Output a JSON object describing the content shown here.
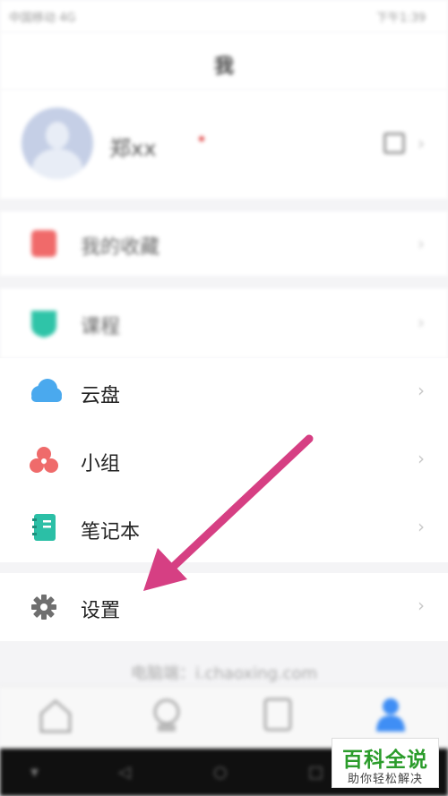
{
  "status_bar": {
    "carrier": "中国移动 4G",
    "time": "下午1:39"
  },
  "header": {
    "title": "我"
  },
  "profile": {
    "name": "郑xx"
  },
  "menu": {
    "favorites_label": "我的收藏",
    "course_label": "课程",
    "cloud_label": "云盘",
    "group_label": "小组",
    "notebook_label": "笔记本",
    "settings_label": "设置"
  },
  "footer": {
    "pc_text": "电脑端：i.chaoxing.com"
  },
  "colors": {
    "arrow": "#d63f83",
    "accent": "#3f8ef5",
    "cloud": "#4aa9ee",
    "group": "#ef6b6b",
    "notebook": "#2bbfa6"
  },
  "watermark": {
    "title": "百科全说",
    "subtitle": "助你轻松解决"
  }
}
